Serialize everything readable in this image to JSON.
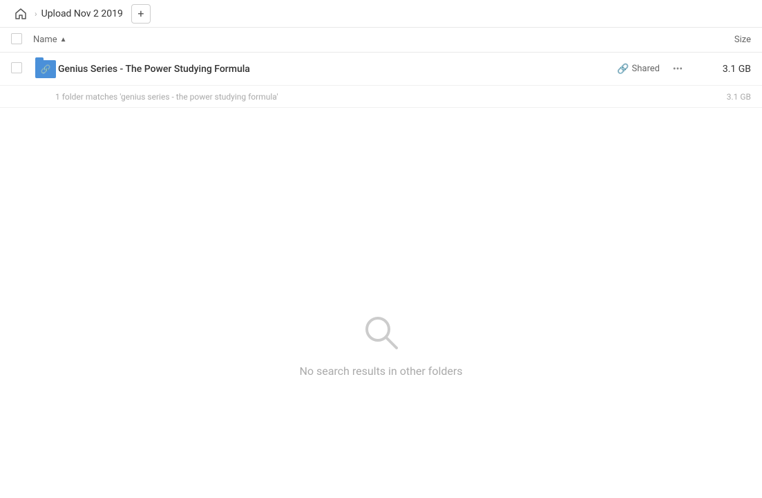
{
  "header": {
    "home_icon": "home-icon",
    "breadcrumb_separator": "›",
    "breadcrumb_text": "Upload Nov 2 2019",
    "add_icon": "+"
  },
  "columns": {
    "name_label": "Name",
    "size_label": "Size"
  },
  "file_row": {
    "name": "Genius Series - The Power Studying Formula",
    "shared_label": "Shared",
    "size": "3.1 GB"
  },
  "match_info": {
    "text": "1 folder matches 'genius series - the power studying formula'",
    "size": "3.1 GB"
  },
  "empty_state": {
    "text": "No search results in other folders"
  }
}
